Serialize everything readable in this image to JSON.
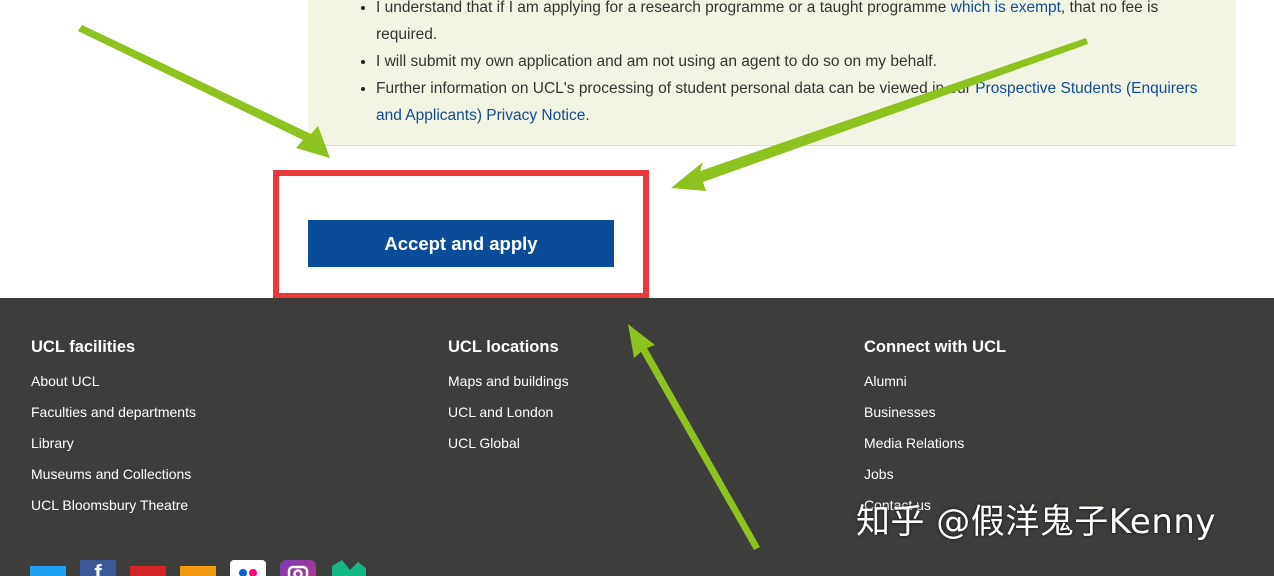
{
  "terms": {
    "items": [
      {
        "text_before": "I understand that if I am applying for a research programme or a taught programme ",
        "link": "which is exempt",
        "text_after": ", that no fee is required."
      },
      {
        "text_before": "I will submit my own application and am not using an agent to do so on my behalf.",
        "link": "",
        "text_after": ""
      },
      {
        "text_before": "Further information on UCL's processing of student personal data can be viewed in our ",
        "link": "Prospective Students (Enquirers and Applicants) Privacy Notice",
        "text_after": "."
      }
    ]
  },
  "action": {
    "accept_label": "Accept and apply"
  },
  "footer": {
    "columns": [
      {
        "heading": "UCL facilities",
        "links": [
          "About UCL",
          "Faculties and departments",
          "Library",
          "Museums and Collections",
          "UCL Bloomsbury Theatre"
        ]
      },
      {
        "heading": "UCL locations",
        "links": [
          "Maps and buildings",
          "UCL and London",
          "UCL Global"
        ]
      },
      {
        "heading": "Connect with UCL",
        "links": [
          "Alumni",
          "Businesses",
          "Media Relations",
          "Jobs",
          "Contact us"
        ]
      }
    ],
    "social": [
      "twitter-icon",
      "facebook-icon",
      "youtube-icon",
      "rss-icon",
      "flickr-icon",
      "instagram-icon",
      "medium-icon"
    ]
  },
  "watermark": "知乎 @假洋鬼子Kenny",
  "colors": {
    "button": "#0b4c99",
    "highlight": "#e8393b",
    "arrow": "#8dc21f",
    "footer_bg": "#3d3d3b",
    "panel_bg": "#f3f5e4",
    "link": "#124b93"
  }
}
